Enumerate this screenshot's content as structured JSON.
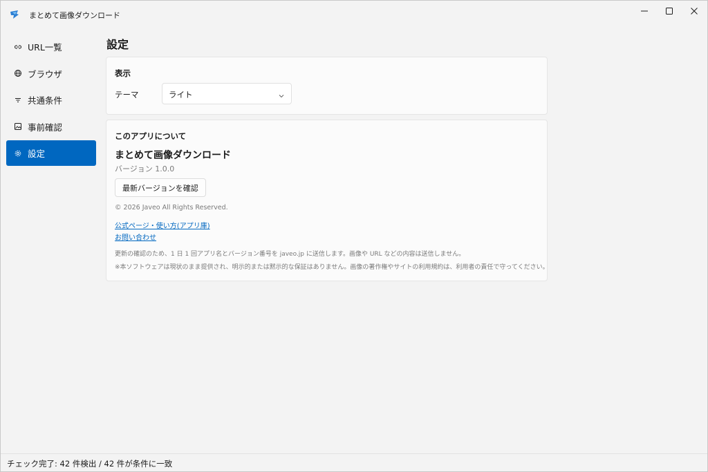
{
  "window": {
    "title": "まとめて画像ダウンロード",
    "accent_color": "#0067c0"
  },
  "sidebar": {
    "items": [
      {
        "label": "URL一覧",
        "icon": "link-icon",
        "active": false
      },
      {
        "label": "ブラウザ",
        "icon": "globe-icon",
        "active": false
      },
      {
        "label": "共通条件",
        "icon": "filter-icon",
        "active": false
      },
      {
        "label": "事前確認",
        "icon": "image-icon",
        "active": false
      },
      {
        "label": "設定",
        "icon": "gear-icon",
        "active": true
      }
    ]
  },
  "main": {
    "page_title": "設定",
    "display_section": {
      "title": "表示",
      "theme_label": "テーマ",
      "theme_value": "ライト"
    },
    "about_section": {
      "title": "このアプリについて",
      "app_name": "まとめて画像ダウンロード",
      "version": "バージョン 1.0.0",
      "check_button": "最新バージョンを確認",
      "copyright": "© 2026 Javeo All Rights Reserved.",
      "link_official": "公式ページ・使い方(アプリ庫)",
      "link_contact": "お問い合わせ",
      "note_1": "更新の確認のため、1 日 1 回アプリ名とバージョン番号を javeo.jp に送信します。画像や URL などの内容は送信しません。",
      "note_2": "※本ソフトウェアは現状のまま提供され、明示的または黙示的な保証はありません。画像の著作権やサイトの利用規約は、利用者の責任で守ってください。"
    }
  },
  "status_bar": {
    "text": "チェック完了: 42 件検出 / 42 件が条件に一致"
  }
}
